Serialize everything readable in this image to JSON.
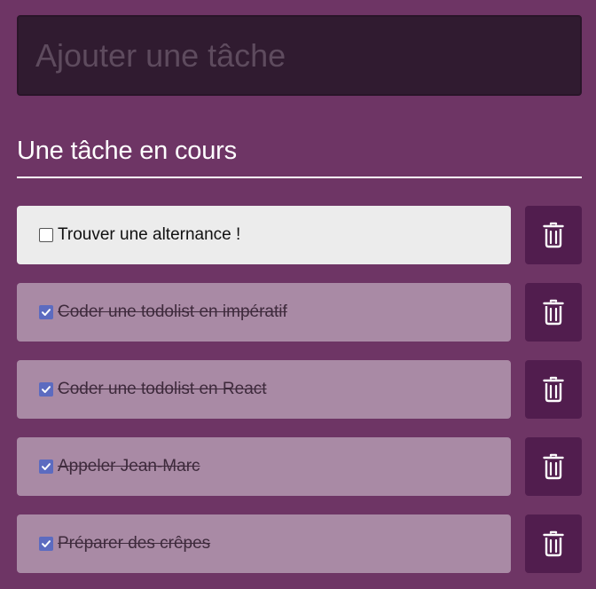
{
  "new_task": {
    "placeholder": "Ajouter une tâche",
    "value": ""
  },
  "section": {
    "title": "Une tâche en cours"
  },
  "tasks": [
    {
      "label": "Trouver une alternance !",
      "done": false
    },
    {
      "label": "Coder une todolist en impératif",
      "done": true
    },
    {
      "label": "Coder une todolist en React",
      "done": true
    },
    {
      "label": "Appeler Jean-Marc",
      "done": true
    },
    {
      "label": "Préparer des crêpes",
      "done": true
    }
  ],
  "icons": {
    "delete": "trash-icon",
    "checkbox": "checkbox-icon"
  },
  "colors": {
    "background": "#6e3565",
    "input_background": "#301b30",
    "pending_card": "#ececec",
    "done_card": "#a98aa5",
    "delete_button": "#511d4e",
    "checkbox_checked": "#5c6bc0"
  }
}
